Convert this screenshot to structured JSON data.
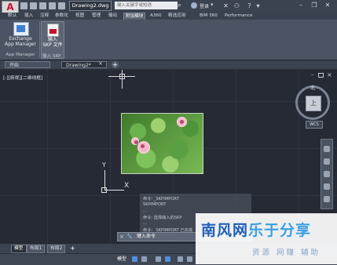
{
  "title_bar": {
    "app_logo": "A",
    "document_tab": "Drawing2.dwg",
    "search_placeholder": "键入关键字或短语",
    "signin_label": "登录",
    "icons": [
      "new-icon",
      "open-icon",
      "save-icon",
      "undo-icon",
      "redo-icon",
      "search-icon",
      "binoculars-icon",
      "user-icon",
      "app-store-icon",
      "network-icon",
      "help-icon",
      "minimize-icon",
      "restore-icon",
      "close-icon"
    ]
  },
  "ribbon_tabs": [
    "默认",
    "插入",
    "注释",
    "参数化",
    "视图",
    "管理",
    "输出",
    "附加模块",
    "A360",
    "精选应用",
    "BIM 360",
    "Performance"
  ],
  "ribbon_tabs_active": "附加模块",
  "ribbon": {
    "exchange": {
      "line1": "Exchange",
      "line2": "App Manager",
      "group": "App Manager"
    },
    "skp": {
      "line1": "输入",
      "line2": "SKP 文件",
      "group": "输入 SKP"
    }
  },
  "file_tabs": {
    "start": "开始",
    "drawing": "Drawing2*",
    "close": "×",
    "add": "+"
  },
  "viewport": {
    "label": "[-][俯视][二维线框]",
    "viewcube_face": "上",
    "viewcube_north": "北",
    "wcs": "WCS"
  },
  "ucs": {
    "x_label": "X",
    "y_label": "Y"
  },
  "command_history": [
    "命令: _SKPIMPORT",
    "SKPIMPORT",
    "...",
    "命令: 选择输入的SKP",
    "...",
    "命令: _SKPIMPORT  已完成"
  ],
  "command_line": {
    "close": "×",
    "prompt": "键入命令"
  },
  "layout_tabs": {
    "model": "模型",
    "layout1": "布局1",
    "layout2": "布局2",
    "add": "+"
  },
  "status_bar": {
    "model_label": "模型"
  },
  "watermark": {
    "name_part1": "南风网",
    "name_part2": "乐于分享",
    "subtitle": "资源 网赚 辅助"
  },
  "colors": {
    "accent": "#4f8fdf",
    "watermark_blue": "#1e5fb8",
    "logo_red": "#c8102e"
  }
}
